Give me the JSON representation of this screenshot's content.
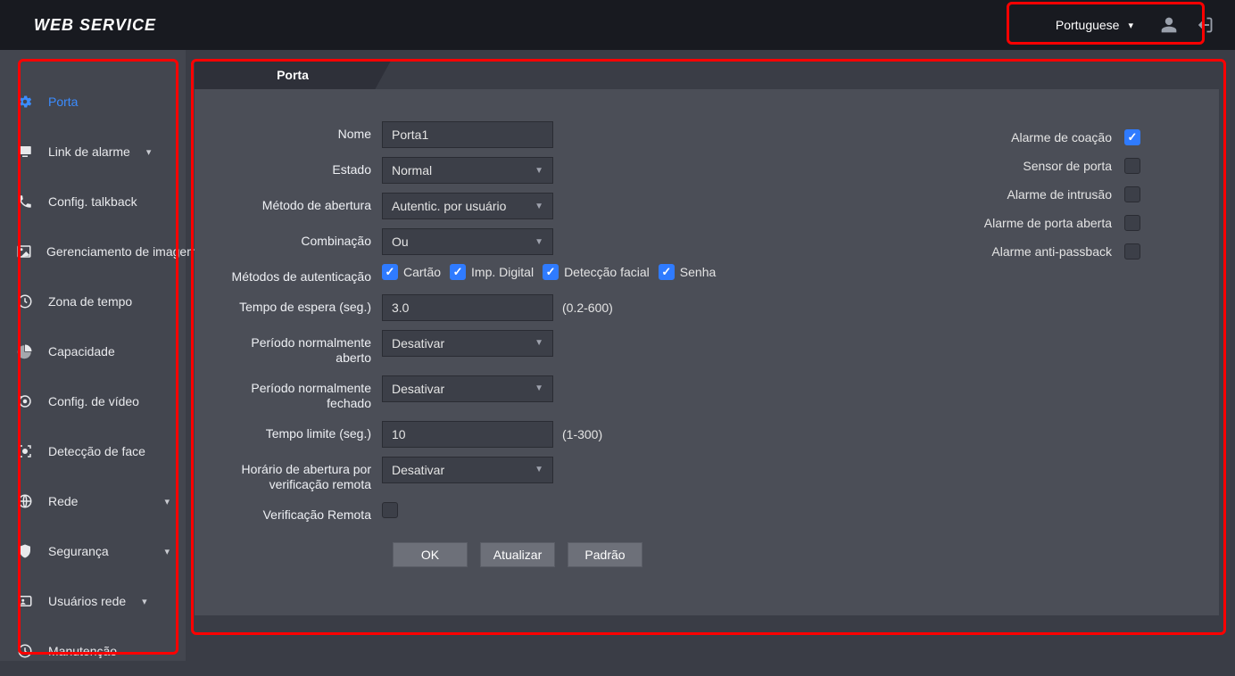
{
  "header": {
    "brand": "WEB SERVICE",
    "language": "Portuguese"
  },
  "sidebar": {
    "items": [
      {
        "label": "Porta",
        "expandable": false
      },
      {
        "label": "Link de alarme",
        "expandable": true
      },
      {
        "label": "Config. talkback",
        "expandable": false
      },
      {
        "label": "Gerenciamento de imagem",
        "expandable": false
      },
      {
        "label": "Zona de tempo",
        "expandable": false
      },
      {
        "label": "Capacidade",
        "expandable": false
      },
      {
        "label": "Config. de vídeo",
        "expandable": false
      },
      {
        "label": "Detecção de face",
        "expandable": false
      },
      {
        "label": "Rede",
        "expandable": true
      },
      {
        "label": "Segurança",
        "expandable": true
      },
      {
        "label": "Usuários rede",
        "expandable": true
      },
      {
        "label": "Manutenção",
        "expandable": false
      }
    ]
  },
  "tab": {
    "label": "Porta"
  },
  "form": {
    "name_label": "Nome",
    "name_value": "Porta1",
    "state_label": "Estado",
    "state_value": "Normal",
    "open_method_label": "Método de abertura",
    "open_method_value": "Autentic. por usuário",
    "combination_label": "Combinação",
    "combination_value": "Ou",
    "auth_methods_label": "Métodos de autenticação",
    "auth_card": "Cartão",
    "auth_finger": "Imp. Digital",
    "auth_face": "Detecção facial",
    "auth_pwd": "Senha",
    "wait_label": "Tempo de espera (seg.)",
    "wait_value": "3.0",
    "wait_hint": "(0.2-600)",
    "norm_open_label": "Período normalmente aberto",
    "norm_open_value": "Desativar",
    "norm_closed_label": "Período normalmente fechado",
    "norm_closed_value": "Desativar",
    "timeout_label": "Tempo limite (seg.)",
    "timeout_value": "10",
    "timeout_hint": "(1-300)",
    "remote_time_label": "Horário de abertura por verificação remota",
    "remote_time_value": "Desativar",
    "remote_verify_label": "Verificação Remota"
  },
  "alarms": {
    "duress": "Alarme de coação",
    "door_sensor": "Sensor de porta",
    "intrusion": "Alarme de intrusão",
    "door_open": "Alarme de porta aberta",
    "anti_passback": "Alarme anti-passback"
  },
  "buttons": {
    "ok": "OK",
    "refresh": "Atualizar",
    "default": "Padrão"
  }
}
